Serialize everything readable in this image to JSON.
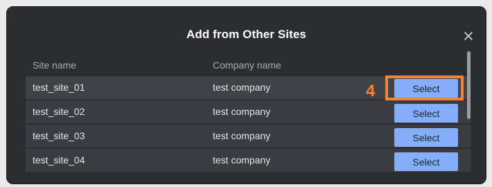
{
  "dialog": {
    "title": "Add from Other Sites",
    "close_icon": "close-icon"
  },
  "table": {
    "headers": {
      "site_name": "Site name",
      "company_name": "Company name"
    },
    "rows": [
      {
        "site": "test_site_01",
        "company": "test company",
        "action": "Select"
      },
      {
        "site": "test_site_02",
        "company": "test company",
        "action": "Select"
      },
      {
        "site": "test_site_03",
        "company": "test company",
        "action": "Select"
      },
      {
        "site": "test_site_04",
        "company": "test company",
        "action": "Select"
      }
    ]
  },
  "annotation": {
    "step_number": "4",
    "color": "#f0853a"
  },
  "colors": {
    "dialog_bg": "#2b2d31",
    "row_bg": "#3a3c41",
    "button_bg": "#84aef9"
  }
}
